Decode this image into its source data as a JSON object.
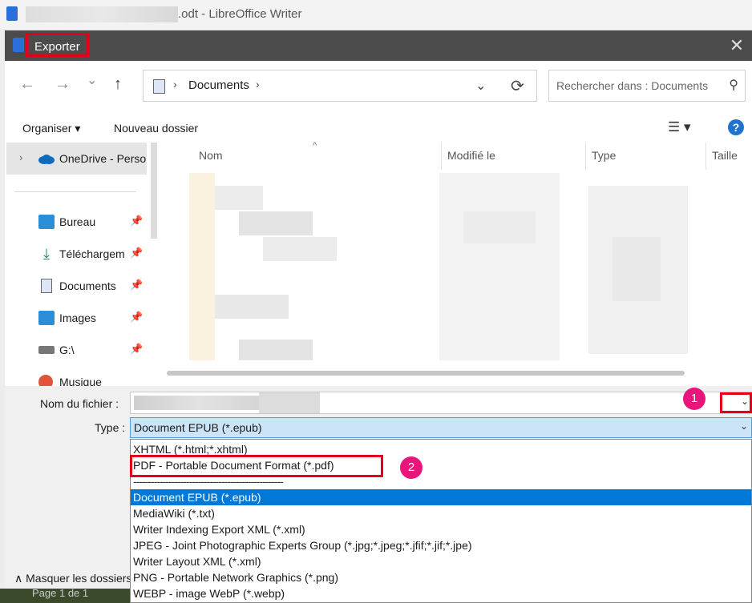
{
  "app": {
    "title_suffix": ".odt - LibreOffice Writer",
    "page_status": "Page 1 de 1"
  },
  "dialog": {
    "title": "Exporter",
    "close_glyph": "✕"
  },
  "nav": {
    "back": "←",
    "forward": "→",
    "recent": "⌄",
    "up": "↑",
    "breadcrumb": "Documents",
    "search_placeholder": "Rechercher dans : Documents"
  },
  "toolbar": {
    "organize": "Organiser ▾",
    "new_folder": "Nouveau dossier",
    "help": "?"
  },
  "sidebar": {
    "onedrive": "OneDrive - Perso",
    "items": [
      {
        "label": "Bureau",
        "icon": "desktop-icon"
      },
      {
        "label": "Téléchargem",
        "icon": "download-icon"
      },
      {
        "label": "Documents",
        "icon": "documents-icon"
      },
      {
        "label": "Images",
        "icon": "images-icon"
      },
      {
        "label": "G:\\",
        "icon": "drive-icon"
      },
      {
        "label": "Musique",
        "icon": "music-icon"
      }
    ]
  },
  "columns": [
    "Nom",
    "Modifié le",
    "Type",
    "Taille"
  ],
  "form": {
    "filename_label": "Nom du fichier :",
    "type_label": "Type :",
    "selected_type": "Document EPUB (*.epub)",
    "hide_folders": "Masquer les dossiers"
  },
  "annotations": {
    "badge1": "1",
    "badge2": "2"
  },
  "type_options": [
    "XHTML (*.html;*.xhtml)",
    "PDF - Portable Document Format (*.pdf)",
    "---------------------------------------------------",
    "Document EPUB (*.epub)",
    "MediaWiki (*.txt)",
    "Writer Indexing Export XML (*.xml)",
    "JPEG - Joint Photographic Experts Group (*.jpg;*.jpeg;*.jfif;*.jif;*.jpe)",
    "Writer Layout XML (*.xml)",
    "PNG - Portable Network Graphics (*.png)",
    "WEBP - image WebP (*.webp)"
  ],
  "colors": {
    "accent": "#0078d7",
    "highlight_box": "#e3001b",
    "badge": "#e8157a"
  }
}
